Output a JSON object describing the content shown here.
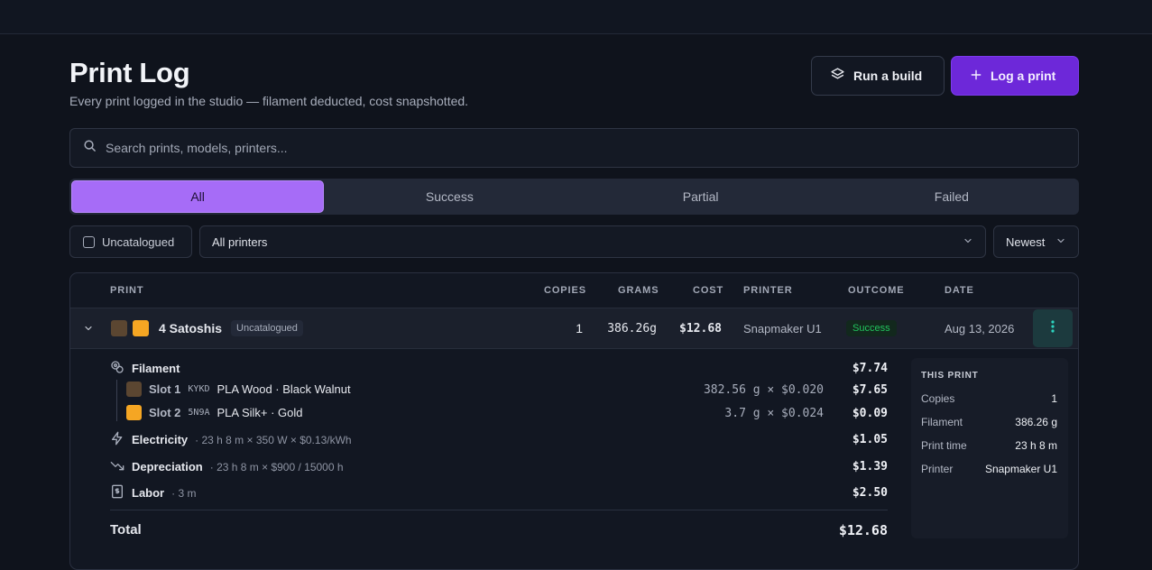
{
  "header": {
    "title": "Print Log",
    "subtitle": "Every print logged in the studio — filament deducted, cost snapshotted.",
    "run_build_label": "Run a build",
    "log_print_label": "Log a print"
  },
  "search": {
    "placeholder": "Search prints, models, printers..."
  },
  "tabs": [
    {
      "label": "All",
      "active": true
    },
    {
      "label": "Success",
      "active": false
    },
    {
      "label": "Partial",
      "active": false
    },
    {
      "label": "Failed",
      "active": false
    }
  ],
  "filters": {
    "uncatalogued_label": "Uncatalogued",
    "printer_select": "All printers",
    "sort_select": "Newest"
  },
  "table": {
    "headers": {
      "print": "PRINT",
      "copies": "COPIES",
      "grams": "GRAMS",
      "cost": "COST",
      "printer": "PRINTER",
      "outcome": "OUTCOME",
      "date": "DATE"
    },
    "row": {
      "name": "4 Satoshis",
      "badge": "Uncatalogued",
      "copies": "1",
      "grams": "386.26g",
      "cost": "$12.68",
      "printer": "Snapmaker U1",
      "outcome": "Success",
      "date": "Aug 13, 2026",
      "swatch_colors": [
        "#5b4631",
        "#f5a623"
      ]
    }
  },
  "detail": {
    "filament_label": "Filament",
    "filament_amount": "$7.74",
    "slots": [
      {
        "slot": "Slot 1",
        "code": "KYKD",
        "material": "PLA Wood · Black Walnut",
        "calc": "382.56 g × $0.020",
        "amount": "$7.65",
        "color": "#5b4631"
      },
      {
        "slot": "Slot 2",
        "code": "5N9A",
        "material": "PLA Silk+ · Gold",
        "calc": "3.7 g × $0.024",
        "amount": "$0.09",
        "color": "#f5a623"
      }
    ],
    "electricity_label": "Electricity",
    "electricity_calc": "· 23 h 8 m × 350 W × $0.13/kWh",
    "electricity_amount": "$1.05",
    "depreciation_label": "Depreciation",
    "depreciation_calc": "· 23 h 8 m × $900 / 15000 h",
    "depreciation_amount": "$1.39",
    "labor_label": "Labor",
    "labor_calc": "· 3 m",
    "labor_amount": "$2.50",
    "total_label": "Total",
    "total_amount": "$12.68"
  },
  "this_print": {
    "heading": "THIS PRINT",
    "copies_label": "Copies",
    "copies": "1",
    "filament_label": "Filament",
    "filament": "386.26 g",
    "print_time_label": "Print time",
    "print_time": "23 h 8 m",
    "printer_label": "Printer",
    "printer": "Snapmaker U1"
  },
  "colors": {
    "accent": "#6d28d9",
    "tab_active": "#a66cf7",
    "success": "#22c55e",
    "kebab": "#2dd4bf"
  }
}
